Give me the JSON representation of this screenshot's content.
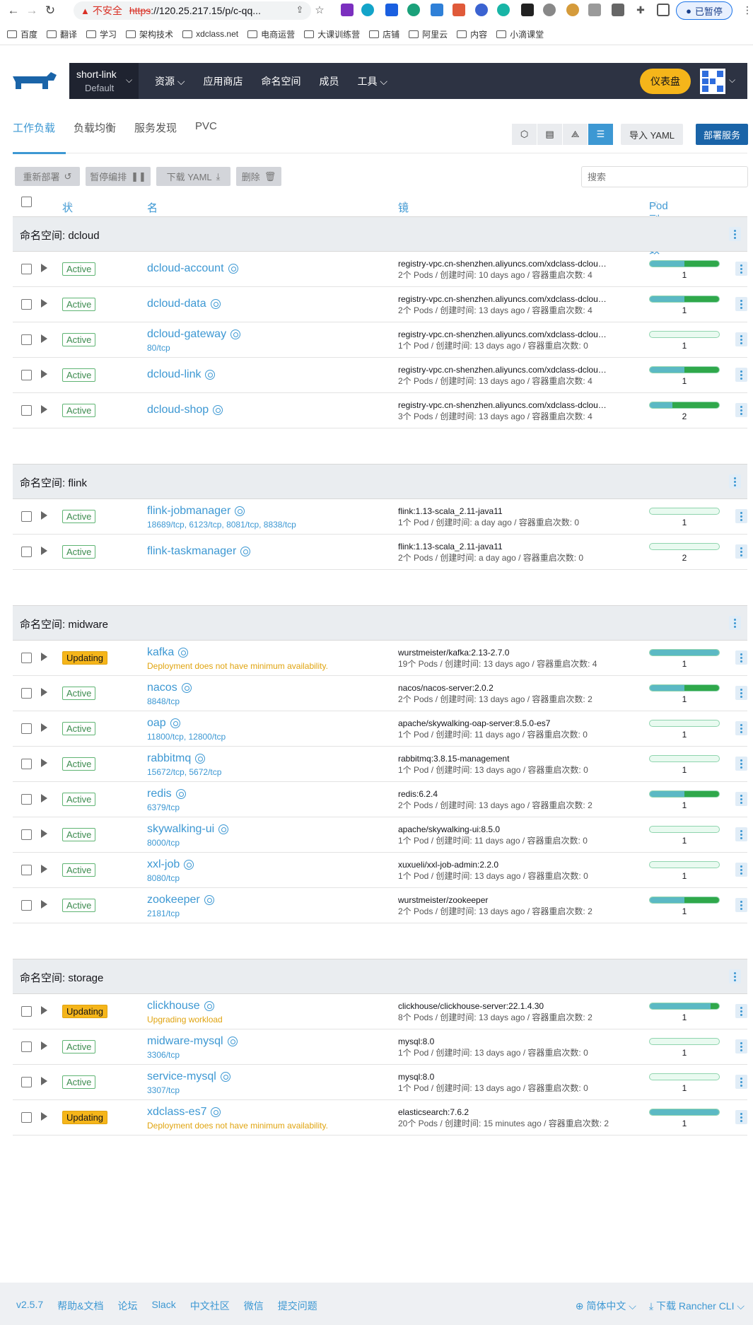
{
  "browser": {
    "insecure": "不安全",
    "url_https": "https",
    "url_rest": "://120.25.217.15/p/c-qq...",
    "paused": "已暂停"
  },
  "bookmarks": [
    "百度",
    "翻译",
    "学习",
    "架构技术",
    "xdclass.net",
    "电商运营",
    "大课训练营",
    "店铺",
    "阿里云",
    "内容",
    "小滴课堂"
  ],
  "header": {
    "cluster_name": "short-link",
    "cluster_project": "Default",
    "nav": [
      "资源",
      "应用商店",
      "命名空间",
      "成员",
      "工具"
    ],
    "dashboard": "仪表盘"
  },
  "tabs": [
    "工作负载",
    "负载均衡",
    "服务发现",
    "PVC"
  ],
  "actions": {
    "import": "导入 YAML",
    "deploy": "部署服务",
    "redeploy": "重新部署",
    "pause": "暂停编排",
    "download": "下载 YAML",
    "delete": "删除",
    "search_placeholder": "搜索"
  },
  "columns": {
    "state": "状态",
    "name": "名称",
    "image": "镜像",
    "pods": "Pod 副本数"
  },
  "namespaces": [
    {
      "label": "命名空间: dcloud",
      "rows": [
        {
          "state": "Active",
          "name": "dcloud-account",
          "sub": "",
          "image": "registry-vpc.cn-shenzhen.aliyuncs.com/xdclass-dcloud/...",
          "meta": "2个 Pods / 创建时间: 10 days ago / 容器重启次数: 4",
          "pods": "1",
          "bar": [
            0.5,
            0.5
          ]
        },
        {
          "state": "Active",
          "name": "dcloud-data",
          "sub": "",
          "image": "registry-vpc.cn-shenzhen.aliyuncs.com/xdclass-dcloud/...",
          "meta": "2个 Pods / 创建时间: 13 days ago / 容器重启次数: 4",
          "pods": "1",
          "bar": [
            0.5,
            0.5
          ]
        },
        {
          "state": "Active",
          "name": "dcloud-gateway",
          "sub": "80/tcp",
          "image": "registry-vpc.cn-shenzhen.aliyuncs.com/xdclass-dcloud/...",
          "meta": "1个 Pod / 创建时间: 13 days ago / 容器重启次数: 0",
          "pods": "1",
          "bar": [
            0,
            0
          ]
        },
        {
          "state": "Active",
          "name": "dcloud-link",
          "sub": "",
          "image": "registry-vpc.cn-shenzhen.aliyuncs.com/xdclass-dcloud/...",
          "meta": "2个 Pods / 创建时间: 13 days ago / 容器重启次数: 4",
          "pods": "1",
          "bar": [
            0.5,
            0.5
          ]
        },
        {
          "state": "Active",
          "name": "dcloud-shop",
          "sub": "",
          "image": "registry-vpc.cn-shenzhen.aliyuncs.com/xdclass-dcloud/...",
          "meta": "3个 Pods / 创建时间: 13 days ago / 容器重启次数: 4",
          "pods": "2",
          "bar": [
            0.33,
            0.67
          ]
        }
      ]
    },
    {
      "label": "命名空间: flink",
      "rows": [
        {
          "state": "Active",
          "name": "flink-jobmanager",
          "sub": "18689/tcp, 6123/tcp, 8081/tcp, 8838/tcp",
          "image": "flink:1.13-scala_2.11-java11",
          "meta": "1个 Pod / 创建时间: a day ago / 容器重启次数: 0",
          "pods": "1",
          "bar": [
            0,
            0
          ]
        },
        {
          "state": "Active",
          "name": "flink-taskmanager",
          "sub": "",
          "image": "flink:1.13-scala_2.11-java11",
          "meta": "2个 Pods / 创建时间: a day ago / 容器重启次数: 0",
          "pods": "2",
          "bar": [
            0,
            0
          ]
        }
      ]
    },
    {
      "label": "命名空间: midware",
      "rows": [
        {
          "state": "Updating",
          "name": "kafka",
          "sub": "Deployment does not have minimum availability.",
          "warn": true,
          "image": "wurstmeister/kafka:2.13-2.7.0",
          "meta": "19个 Pods / 创建时间: 13 days ago / 容器重启次数: 4",
          "pods": "1",
          "bar": [
            1,
            0
          ]
        },
        {
          "state": "Active",
          "name": "nacos",
          "sub": "8848/tcp",
          "image": "nacos/nacos-server:2.0.2",
          "meta": "2个 Pods / 创建时间: 13 days ago / 容器重启次数: 2",
          "pods": "1",
          "bar": [
            0.5,
            0.5
          ]
        },
        {
          "state": "Active",
          "name": "oap",
          "sub": "11800/tcp, 12800/tcp",
          "image": "apache/skywalking-oap-server:8.5.0-es7",
          "meta": "1个 Pod / 创建时间: 11 days ago / 容器重启次数: 0",
          "pods": "1",
          "bar": [
            0,
            0
          ]
        },
        {
          "state": "Active",
          "name": "rabbitmq",
          "sub": "15672/tcp, 5672/tcp",
          "image": "rabbitmq:3.8.15-management",
          "meta": "1个 Pod / 创建时间: 13 days ago / 容器重启次数: 0",
          "pods": "1",
          "bar": [
            0,
            0
          ]
        },
        {
          "state": "Active",
          "name": "redis",
          "sub": "6379/tcp",
          "image": "redis:6.2.4",
          "meta": "2个 Pods / 创建时间: 13 days ago / 容器重启次数: 2",
          "pods": "1",
          "bar": [
            0.5,
            0.5
          ]
        },
        {
          "state": "Active",
          "name": "skywalking-ui",
          "sub": "8000/tcp",
          "image": "apache/skywalking-ui:8.5.0",
          "meta": "1个 Pod / 创建时间: 11 days ago / 容器重启次数: 0",
          "pods": "1",
          "bar": [
            0,
            0
          ]
        },
        {
          "state": "Active",
          "name": "xxl-job",
          "sub": "8080/tcp",
          "image": "xuxueli/xxl-job-admin:2.2.0",
          "meta": "1个 Pod / 创建时间: 13 days ago / 容器重启次数: 0",
          "pods": "1",
          "bar": [
            0,
            0
          ]
        },
        {
          "state": "Active",
          "name": "zookeeper",
          "sub": "2181/tcp",
          "image": "wurstmeister/zookeeper",
          "meta": "2个 Pods / 创建时间: 13 days ago / 容器重启次数: 2",
          "pods": "1",
          "bar": [
            0.5,
            0.5
          ]
        }
      ]
    },
    {
      "label": "命名空间: storage",
      "rows": [
        {
          "state": "Updating",
          "name": "clickhouse",
          "sub": "Upgrading workload",
          "warn": true,
          "image": "clickhouse/clickhouse-server:22.1.4.30",
          "meta": "8个 Pods / 创建时间: 13 days ago / 容器重启次数: 2",
          "pods": "1",
          "bar": [
            0.88,
            0.12
          ]
        },
        {
          "state": "Active",
          "name": "midware-mysql",
          "sub": "3306/tcp",
          "image": "mysql:8.0",
          "meta": "1个 Pod / 创建时间: 13 days ago / 容器重启次数: 0",
          "pods": "1",
          "bar": [
            0,
            0
          ]
        },
        {
          "state": "Active",
          "name": "service-mysql",
          "sub": "3307/tcp",
          "image": "mysql:8.0",
          "meta": "1个 Pod / 创建时间: 13 days ago / 容器重启次数: 0",
          "pods": "1",
          "bar": [
            0,
            0
          ]
        },
        {
          "state": "Updating",
          "name": "xdclass-es7",
          "sub": "Deployment does not have minimum availability.",
          "warn": true,
          "image": "elasticsearch:7.6.2",
          "meta": "20个 Pods / 创建时间: 15 minutes ago / 容器重启次数: 2",
          "pods": "1",
          "bar": [
            1,
            0
          ]
        }
      ]
    }
  ],
  "footer": {
    "left": [
      "v2.5.7",
      "帮助&文档",
      "论坛",
      "Slack",
      "中文社区",
      "微信",
      "提交问题"
    ],
    "lang": "简体中文",
    "cli": "下载 Rancher CLI"
  }
}
